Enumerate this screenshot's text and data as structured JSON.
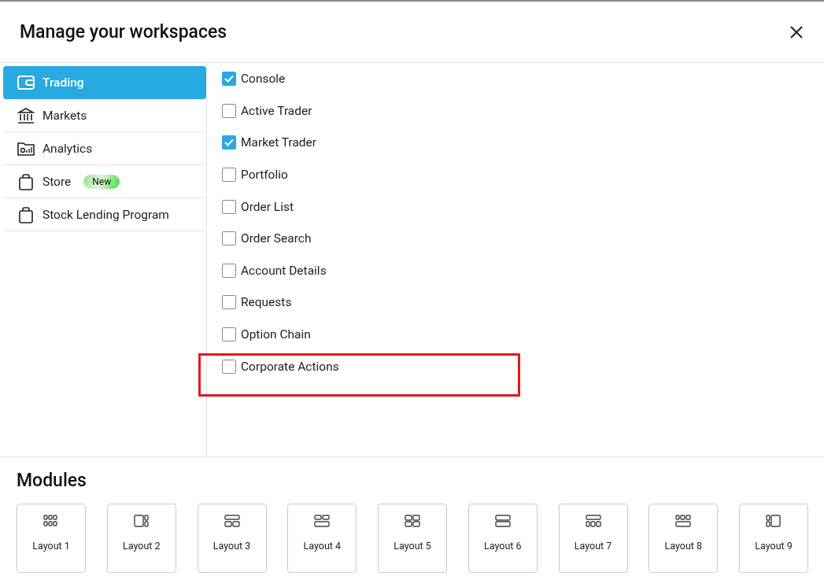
{
  "dialog": {
    "title": "Manage your workspaces"
  },
  "sidebar": {
    "items": [
      {
        "label": "Trading",
        "selected": true
      },
      {
        "label": "Markets",
        "selected": false
      },
      {
        "label": "Analytics",
        "selected": false
      },
      {
        "label": "Store",
        "selected": false,
        "badge": "New"
      },
      {
        "label": "Stock Lending Program",
        "selected": false
      }
    ]
  },
  "widgets": [
    {
      "label": "Console",
      "checked": true,
      "highlighted": false
    },
    {
      "label": "Active Trader",
      "checked": false,
      "highlighted": false
    },
    {
      "label": "Market Trader",
      "checked": true,
      "highlighted": false
    },
    {
      "label": "Portfolio",
      "checked": false,
      "highlighted": false
    },
    {
      "label": "Order List",
      "checked": false,
      "highlighted": false
    },
    {
      "label": "Order Search",
      "checked": false,
      "highlighted": false
    },
    {
      "label": "Account Details",
      "checked": false,
      "highlighted": false
    },
    {
      "label": "Requests",
      "checked": false,
      "highlighted": false
    },
    {
      "label": "Option Chain",
      "checked": false,
      "highlighted": false
    },
    {
      "label": "Corporate Actions",
      "checked": false,
      "highlighted": true
    }
  ],
  "modules": {
    "title": "Modules",
    "layouts": [
      {
        "label": "Layout 1"
      },
      {
        "label": "Layout 2"
      },
      {
        "label": "Layout 3"
      },
      {
        "label": "Layout 4"
      },
      {
        "label": "Layout 5"
      },
      {
        "label": "Layout 6"
      },
      {
        "label": "Layout 7"
      },
      {
        "label": "Layout 8"
      },
      {
        "label": "Layout 9"
      }
    ]
  }
}
